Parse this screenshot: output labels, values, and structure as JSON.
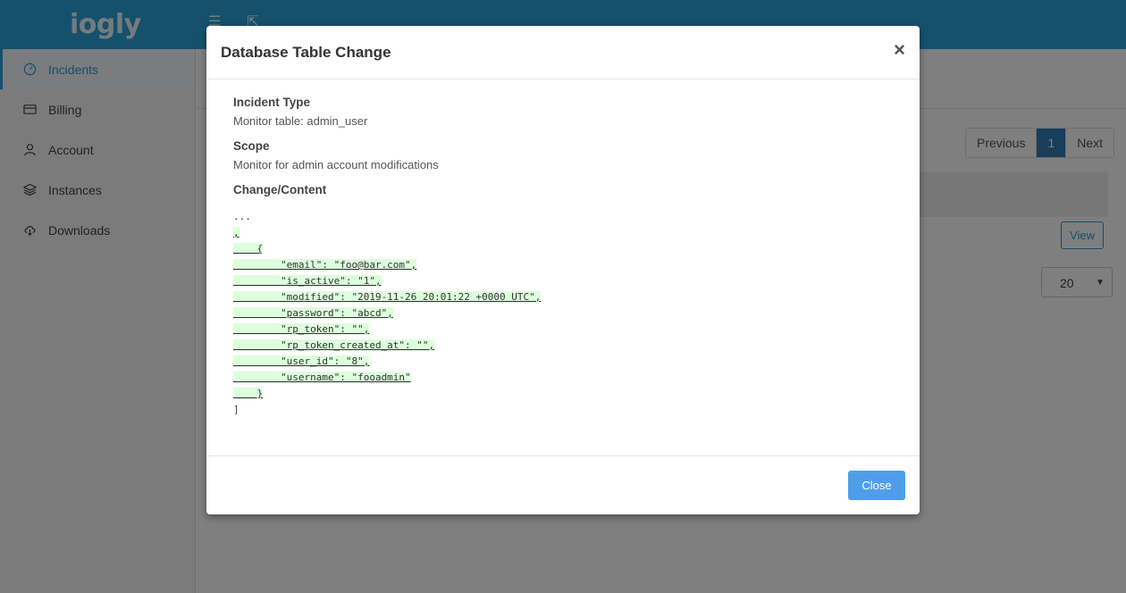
{
  "app": {
    "logo": "iogly"
  },
  "sidebar": {
    "items": [
      {
        "label": "Incidents",
        "icon": "gauge-icon",
        "active": true
      },
      {
        "label": "Billing",
        "icon": "credit-card-icon"
      },
      {
        "label": "Account",
        "icon": "user-icon"
      },
      {
        "label": "Instances",
        "icon": "layers-icon"
      },
      {
        "label": "Downloads",
        "icon": "cloud-download-icon"
      }
    ]
  },
  "background": {
    "pagination": {
      "previous": "Previous",
      "current": "1",
      "next": "Next"
    },
    "view_label": "View",
    "page_size": "20"
  },
  "modal": {
    "title": "Database Table Change",
    "close_symbol": "×",
    "incident_type_label": "Incident Type",
    "incident_type_value": "Monitor table: admin_user",
    "scope_label": "Scope",
    "scope_value": "Monitor for admin account modifications",
    "change_label": "Change/Content",
    "code_lines": [
      "...",
      ",",
      "    {",
      "        \"email\": \"foo@bar.com\",",
      "        \"is_active\": \"1\",",
      "        \"modified\": \"2019-11-26 20:01:22 +0000 UTC\",",
      "        \"password\": \"abcd\",",
      "        \"rp_token\": \"\",",
      "        \"rp_token_created_at\": \"\",",
      "        \"user_id\": \"8\",",
      "        \"username\": \"fooadmin\"",
      "    }",
      "]"
    ],
    "close_button": "Close"
  }
}
